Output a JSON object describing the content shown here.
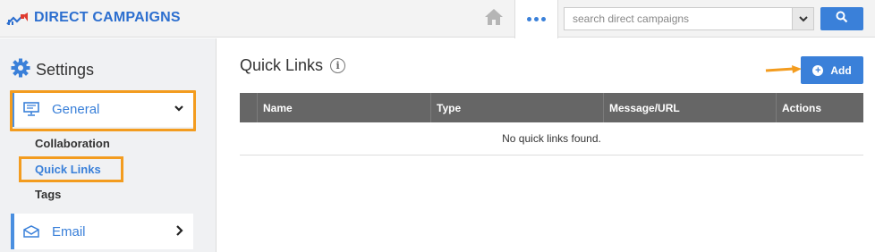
{
  "app": {
    "title": "DIRECT CAMPAIGNS",
    "accent": "#3a80d9",
    "highlight": "#f39c1f"
  },
  "topbar": {
    "home_icon": "home-icon",
    "more_icon": "more-dots-icon",
    "search": {
      "placeholder": "search direct campaigns",
      "value": ""
    },
    "search_button_icon": "search-icon"
  },
  "sidebar": {
    "title": "Settings",
    "general": {
      "label": "General",
      "icon": "monitor-icon",
      "expanded": true
    },
    "sub_items": [
      {
        "label": "Collaboration",
        "active": false
      },
      {
        "label": "Quick Links",
        "active": true
      },
      {
        "label": "Tags",
        "active": false
      }
    ],
    "email": {
      "label": "Email",
      "icon": "envelope-icon"
    }
  },
  "main": {
    "title": "Quick Links",
    "add_label": "Add",
    "table": {
      "columns": [
        "",
        "Name",
        "Type",
        "Message/URL",
        "Actions"
      ],
      "empty_text": "No quick links found."
    }
  }
}
